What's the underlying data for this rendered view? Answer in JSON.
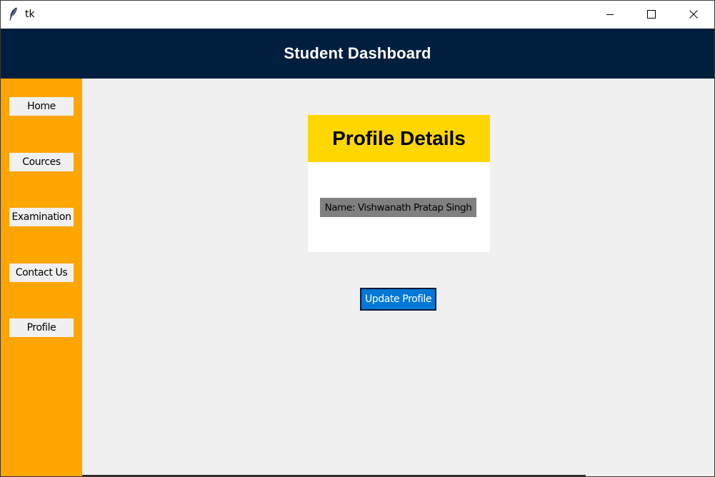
{
  "window": {
    "title": "tk",
    "app_icon": "feather-icon",
    "controls": {
      "minimize": "minimize-icon",
      "maximize": "maximize-icon",
      "close": "close-icon"
    }
  },
  "header": {
    "title": "Student Dashboard",
    "background": "#001f3f"
  },
  "sidebar": {
    "background": "#ffa500",
    "items": [
      {
        "label": "Home"
      },
      {
        "label": "Cources"
      },
      {
        "label": "Examination"
      },
      {
        "label": "Contact Us"
      },
      {
        "label": "Profile"
      }
    ]
  },
  "profile": {
    "title": "Profile Details",
    "title_background": "#ffd700",
    "name_text": "Name: Vishwanath Pratap Singh",
    "update_button_label": "Update Profile",
    "update_button_color": "#0078d7"
  }
}
